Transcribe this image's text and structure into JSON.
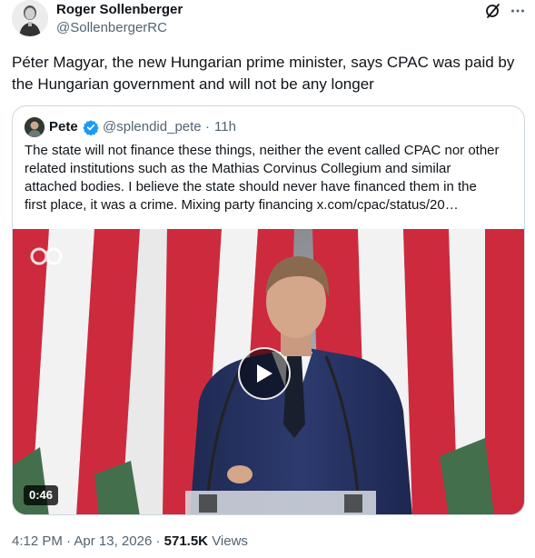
{
  "author": {
    "name": "Roger Sollenberger",
    "handle": "@SollenbergerRC"
  },
  "icons": {
    "grok": "grok-icon",
    "more": "more-icon"
  },
  "tweet": {
    "text_line1": "Péter Magyar, the new Hungarian prime minister, says CPAC was paid by",
    "text_line2": "the Hungarian government and will not be any longer"
  },
  "quote": {
    "name": "Pete",
    "handle": "@splendid_pete",
    "separator": "·",
    "time": "11h",
    "verified_color": "#1d9bf0",
    "lines": [
      "The state will not finance these things, neither the event called CPAC nor other",
      "related institutions such as the Mathias Corvinus Collegium and similar",
      "attached bodies. I believe the state should never have financed them in the"
    ],
    "last_line": "first place, it was a crime. Mixing party financing ",
    "link": "x.com/cpac/status/20…"
  },
  "media": {
    "duration": "0:46",
    "flag_colors": [
      "#cd2a3e",
      "#f4f4f4",
      "#436f4d"
    ]
  },
  "footer": {
    "time": "4:12 PM",
    "date": "Apr 13, 2026",
    "sep1": "·",
    "sep2": "·",
    "views_count": "571.5K",
    "views_label": "Views"
  }
}
